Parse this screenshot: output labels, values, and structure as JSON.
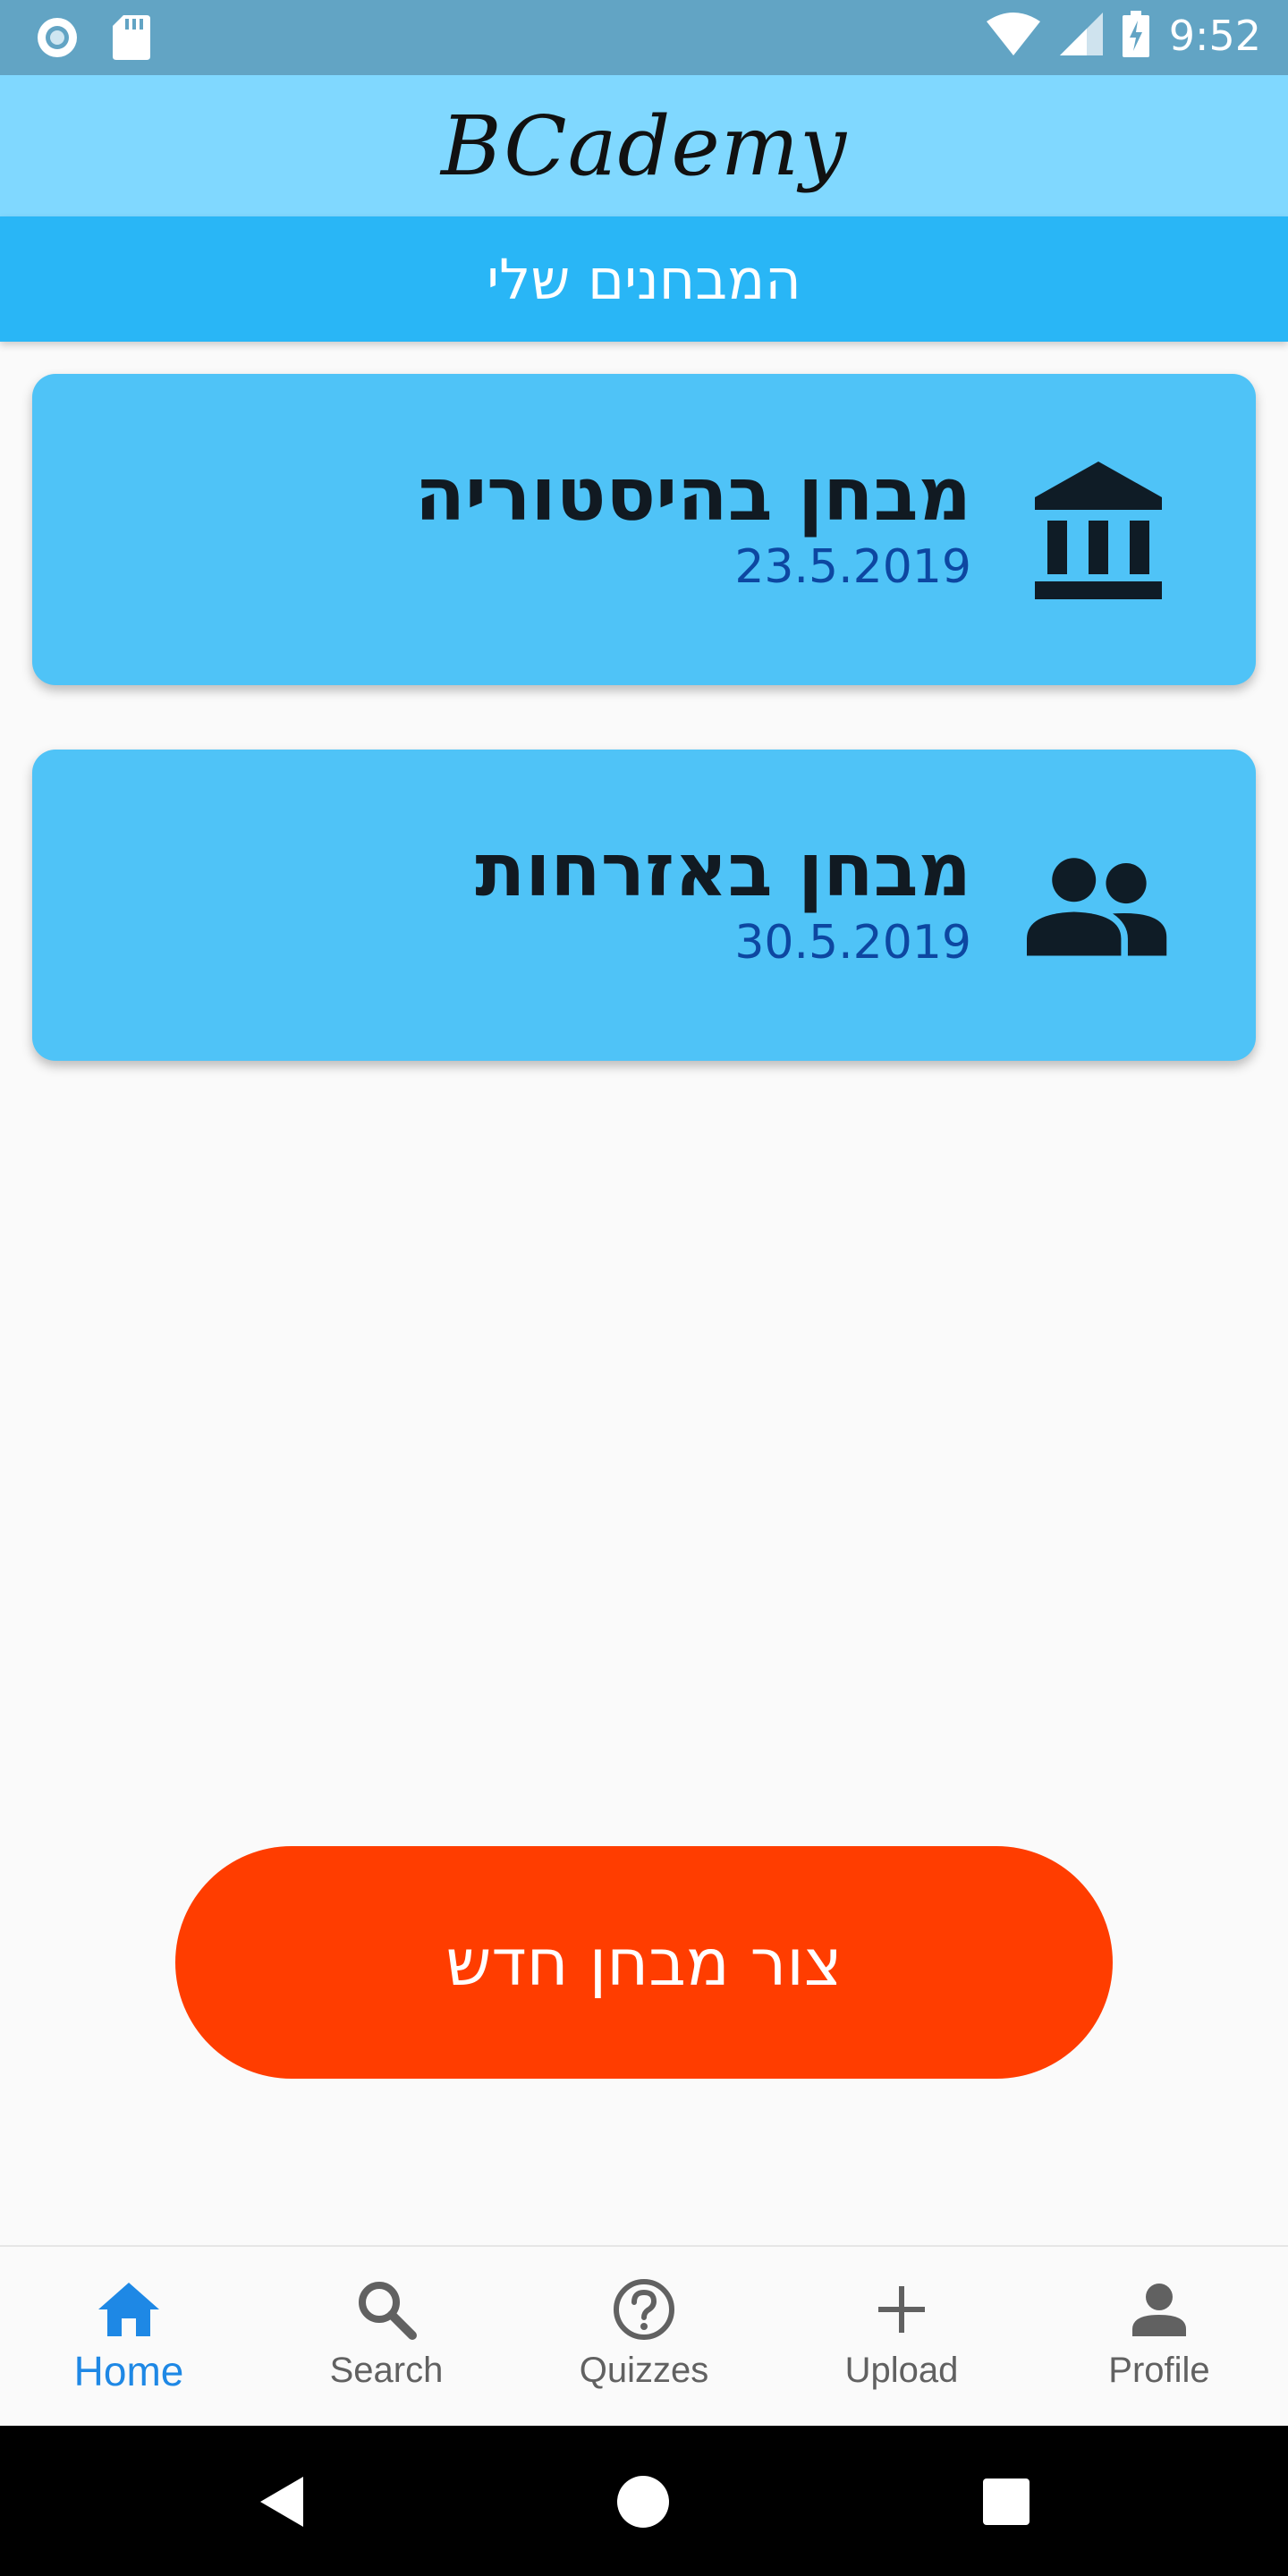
{
  "status_bar": {
    "time": "9:52",
    "icons": [
      "record-icon",
      "sd-card-icon",
      "wifi-icon",
      "signal-icon",
      "battery-charging-icon"
    ]
  },
  "app_bar": {
    "logo_text": "BCademy"
  },
  "sub_header": {
    "title": "המבחנים שלי"
  },
  "quizzes": [
    {
      "title": "מבחן בהיסטוריה",
      "date": "23.5.2019",
      "icon": "museum-icon"
    },
    {
      "title": "מבחן באזרחות",
      "date": "30.5.2019",
      "icon": "people-icon"
    }
  ],
  "create_button": {
    "label": "צור מבחן חדש"
  },
  "bottom_nav": {
    "items": [
      {
        "label": "Home",
        "icon": "home-icon",
        "active": true
      },
      {
        "label": "Search",
        "icon": "search-icon",
        "active": false
      },
      {
        "label": "Quizzes",
        "icon": "help-circle-icon",
        "active": false
      },
      {
        "label": "Upload",
        "icon": "plus-icon",
        "active": false
      },
      {
        "label": "Profile",
        "icon": "person-icon",
        "active": false
      }
    ]
  },
  "colors": {
    "status_bar": "#62a4c4",
    "app_bar": "#80d8ff",
    "sub_header": "#29b6f6",
    "card": "#4fc3f7",
    "date_text": "#0d47a1",
    "create_button": "#ff3d00",
    "nav_active": "#1e88e5",
    "nav_inactive": "#616161"
  }
}
